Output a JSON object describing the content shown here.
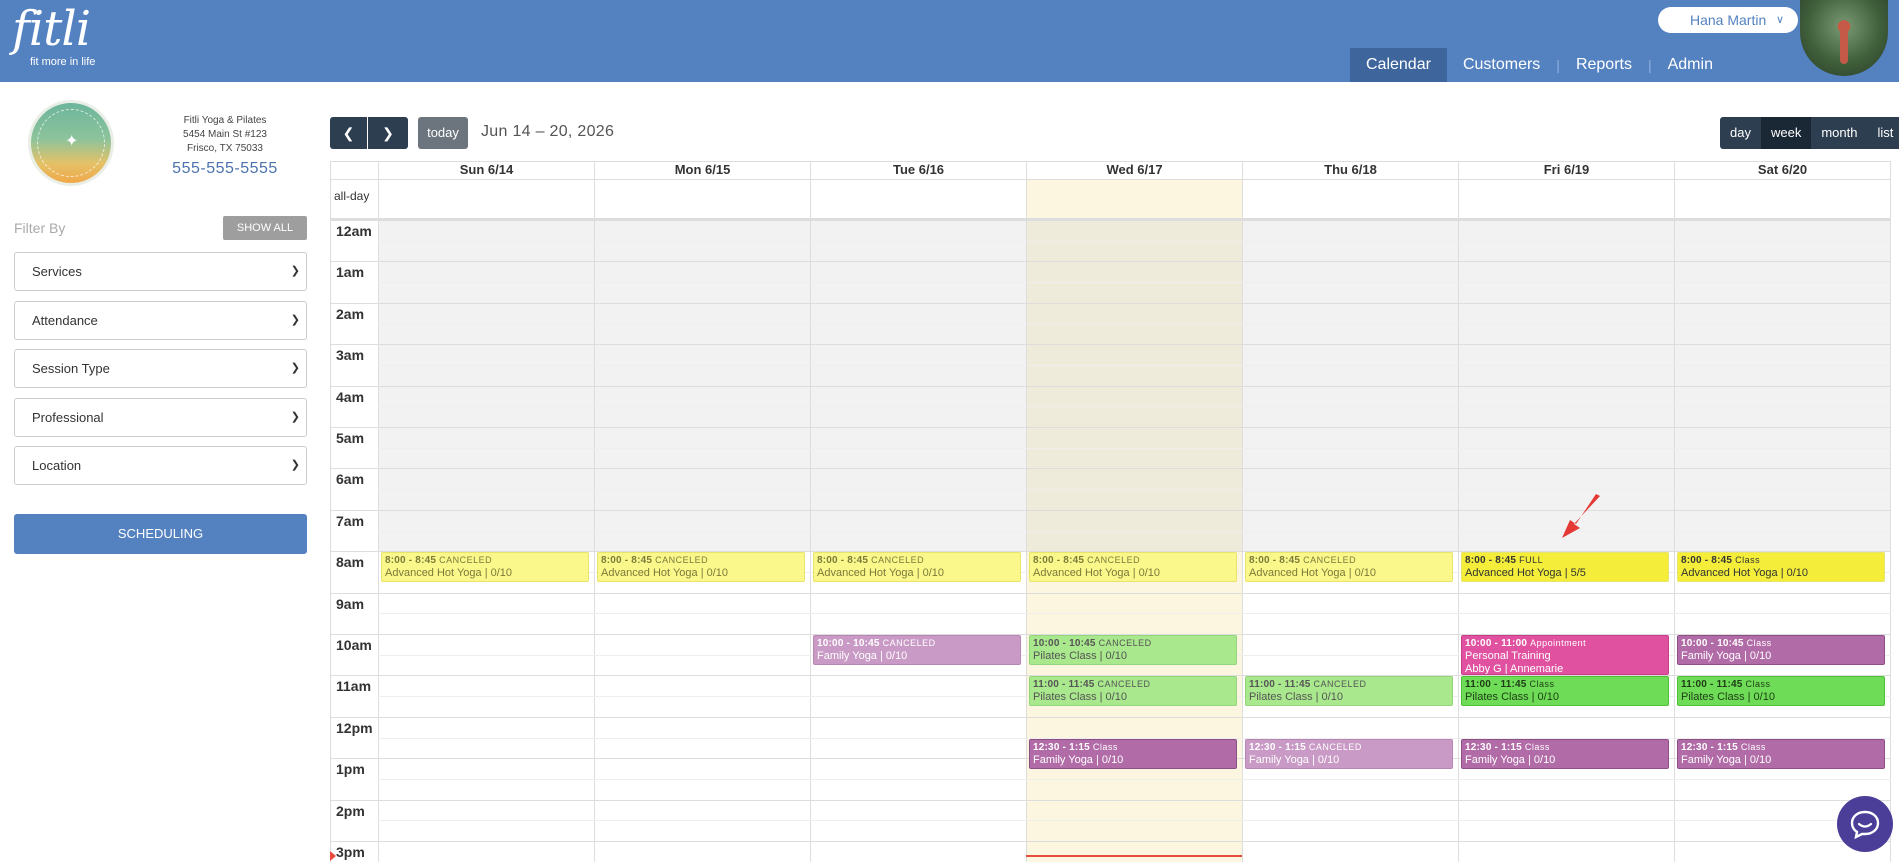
{
  "header": {
    "logo_word": "fitli",
    "logo_tagline": "fit more in life",
    "user_name": "Hana Martin",
    "nav": [
      "Calendar",
      "Customers",
      "Reports",
      "Admin"
    ],
    "active_nav": "Calendar",
    "brand_color": "#5482c0"
  },
  "studio": {
    "name": "Fitli Yoga & Pilates",
    "address1": "5454 Main St #123",
    "address2": "Frisco, TX 75033",
    "phone": "555-555-5555"
  },
  "sidebar": {
    "filter_label": "Filter By",
    "show_all": "SHOW ALL",
    "filters": [
      "Services",
      "Attendance",
      "Session Type",
      "Professional",
      "Location"
    ],
    "scheduling": "SCHEDULING"
  },
  "toolbar": {
    "prev_icon": "chevron-left-icon",
    "next_icon": "chevron-right-icon",
    "today": "today",
    "range": "Jun 14 – 20, 2026",
    "views": [
      "day",
      "week",
      "month",
      "list"
    ],
    "active_view": "week"
  },
  "calendar": {
    "days": [
      "Sun 6/14",
      "Mon 6/15",
      "Tue 6/16",
      "Wed 6/17",
      "Thu 6/18",
      "Fri 6/19",
      "Sat 6/20"
    ],
    "today_index": 3,
    "allday_label": "all-day",
    "hours": [
      "12am",
      "1am",
      "2am",
      "3am",
      "4am",
      "5am",
      "6am",
      "7am",
      "8am",
      "9am",
      "10am",
      "11am",
      "12pm",
      "1pm",
      "2pm",
      "3pm"
    ],
    "events": [
      {
        "day": 0,
        "start": 8,
        "end": 8.75,
        "time": "8:00 - 8:45",
        "status": "CANCELED",
        "name": "Advanced Hot Yoga | 0/10",
        "style": "yellow dim"
      },
      {
        "day": 1,
        "start": 8,
        "end": 8.75,
        "time": "8:00 - 8:45",
        "status": "CANCELED",
        "name": "Advanced Hot Yoga | 0/10",
        "style": "yellow dim"
      },
      {
        "day": 2,
        "start": 8,
        "end": 8.75,
        "time": "8:00 - 8:45",
        "status": "CANCELED",
        "name": "Advanced Hot Yoga | 0/10",
        "style": "yellow dim"
      },
      {
        "day": 3,
        "start": 8,
        "end": 8.75,
        "time": "8:00 - 8:45",
        "status": "CANCELED",
        "name": "Advanced Hot Yoga | 0/10",
        "style": "yellow dim"
      },
      {
        "day": 4,
        "start": 8,
        "end": 8.75,
        "time": "8:00 - 8:45",
        "status": "CANCELED",
        "name": "Advanced Hot Yoga | 0/10",
        "style": "yellow dim"
      },
      {
        "day": 5,
        "start": 8,
        "end": 8.75,
        "time": "8:00 - 8:45",
        "status": "FULL",
        "name": "Advanced Hot Yoga | 5/5",
        "style": "yellow full"
      },
      {
        "day": 6,
        "start": 8,
        "end": 8.75,
        "time": "8:00 - 8:45",
        "status": "Class",
        "name": "Advanced Hot Yoga | 0/10",
        "style": "yellow full"
      },
      {
        "day": 2,
        "start": 10,
        "end": 10.75,
        "time": "10:00 - 10:45",
        "status": "CANCELED",
        "name": "Family Yoga | 0/10",
        "style": "pink"
      },
      {
        "day": 3,
        "start": 10,
        "end": 10.75,
        "time": "10:00 - 10:45",
        "status": "CANCELED",
        "name": "Pilates Class | 0/10",
        "style": "green"
      },
      {
        "day": 5,
        "start": 10,
        "end": 11,
        "time": "10:00 - 11:00",
        "status": "Appointment",
        "name": "Personal Training",
        "name2": "Abby G | Annemarie",
        "style": "magenta"
      },
      {
        "day": 6,
        "start": 10,
        "end": 10.75,
        "time": "10:00 - 10:45",
        "status": "Class",
        "name": "Family Yoga | 0/10",
        "style": "purple"
      },
      {
        "day": 3,
        "start": 11,
        "end": 11.75,
        "time": "11:00 - 11:45",
        "status": "CANCELED",
        "name": "Pilates Class | 0/10",
        "style": "green"
      },
      {
        "day": 4,
        "start": 11,
        "end": 11.75,
        "time": "11:00 - 11:45",
        "status": "CANCELED",
        "name": "Pilates Class | 0/10",
        "style": "green"
      },
      {
        "day": 5,
        "start": 11,
        "end": 11.75,
        "time": "11:00 - 11:45",
        "status": "Class",
        "name": "Pilates Class | 0/10",
        "style": "green strong"
      },
      {
        "day": 6,
        "start": 11,
        "end": 11.75,
        "time": "11:00 - 11:45",
        "status": "Class",
        "name": "Pilates Class | 0/10",
        "style": "green strong"
      },
      {
        "day": 3,
        "start": 12.5,
        "end": 13.25,
        "time": "12:30 - 1:15",
        "status": "Class",
        "name": "Family Yoga | 0/10",
        "style": "purple"
      },
      {
        "day": 4,
        "start": 12.5,
        "end": 13.25,
        "time": "12:30 - 1:15",
        "status": "CANCELED",
        "name": "Family Yoga | 0/10",
        "style": "pink"
      },
      {
        "day": 5,
        "start": 12.5,
        "end": 13.25,
        "time": "12:30 - 1:15",
        "status": "Class",
        "name": "Family Yoga | 0/10",
        "style": "purple"
      },
      {
        "day": 6,
        "start": 12.5,
        "end": 13.25,
        "time": "12:30 - 1:15",
        "status": "Class",
        "name": "Family Yoga | 0/10",
        "style": "purple"
      }
    ]
  },
  "chat_icon": "chat-bubble-icon"
}
